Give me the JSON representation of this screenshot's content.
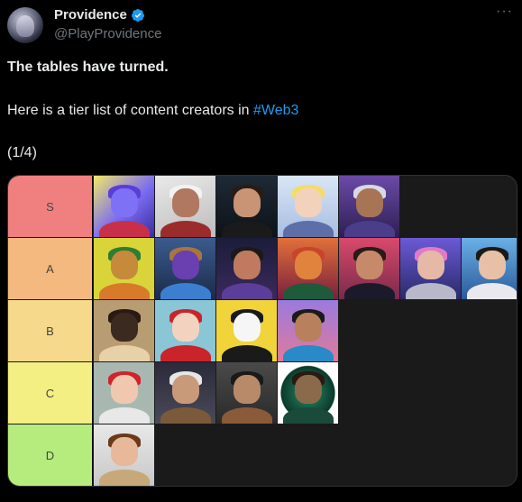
{
  "author": {
    "display_name": "Providence",
    "handle": "@PlayProvidence",
    "verified_badge_color": "#1d9bf0"
  },
  "menu_icon": "more-icon",
  "tweet": {
    "line1": "The tables have turned.",
    "line2_prefix": "Here is a tier list of content creators in ",
    "hashtag": "#Web3",
    "line3": "(1/4)"
  },
  "tier_list": {
    "tiers": [
      {
        "label": "S",
        "color": "#f08080",
        "count": 5
      },
      {
        "label": "A",
        "color": "#f4b97e",
        "count": 7
      },
      {
        "label": "B",
        "color": "#f6d98a",
        "count": 4
      },
      {
        "label": "C",
        "color": "#f3ef83",
        "count": 4
      },
      {
        "label": "D",
        "color": "#b6ec7e",
        "count": 1
      }
    ]
  }
}
